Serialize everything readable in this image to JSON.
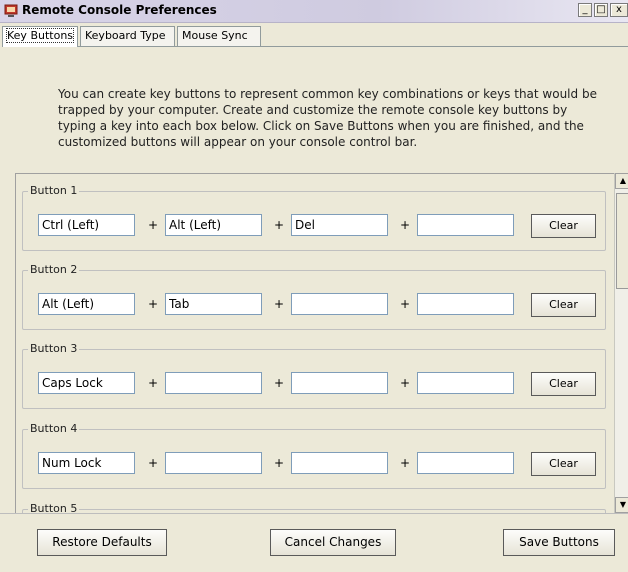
{
  "window": {
    "title": "Remote Console Preferences",
    "minimize_label": "_",
    "maximize_label": "□",
    "close_label": "x"
  },
  "tabs": [
    {
      "label": "Key Buttons",
      "active": true
    },
    {
      "label": "Keyboard Type",
      "active": false
    },
    {
      "label": "Mouse Sync",
      "active": false
    }
  ],
  "intro_text": "You can create key buttons to represent common key combinations or keys that would be trapped by your computer.  Create and customize the remote console key buttons by typing a key into each box below.  Click on Save Buttons when you are finished, and the customized buttons will appear on your console control bar.",
  "plus_sign": "+",
  "clear_label": "Clear",
  "buttons": [
    {
      "label": "Button 1",
      "keys": [
        "Ctrl (Left)",
        "Alt (Left)",
        "Del",
        ""
      ]
    },
    {
      "label": "Button 2",
      "keys": [
        "Alt (Left)",
        "Tab",
        "",
        ""
      ]
    },
    {
      "label": "Button 3",
      "keys": [
        "Caps Lock",
        "",
        "",
        ""
      ]
    },
    {
      "label": "Button 4",
      "keys": [
        "Num Lock",
        "",
        "",
        ""
      ]
    },
    {
      "label": "Button 5",
      "keys": [
        "",
        "",
        "",
        ""
      ]
    }
  ],
  "footer": {
    "restore_label": "Restore Defaults",
    "cancel_label": "Cancel Changes",
    "save_label": "Save Buttons"
  },
  "colors": {
    "window_bg": "#ece9d8",
    "titlebar": "#d8d4e8",
    "input_border": "#7f9db9"
  }
}
